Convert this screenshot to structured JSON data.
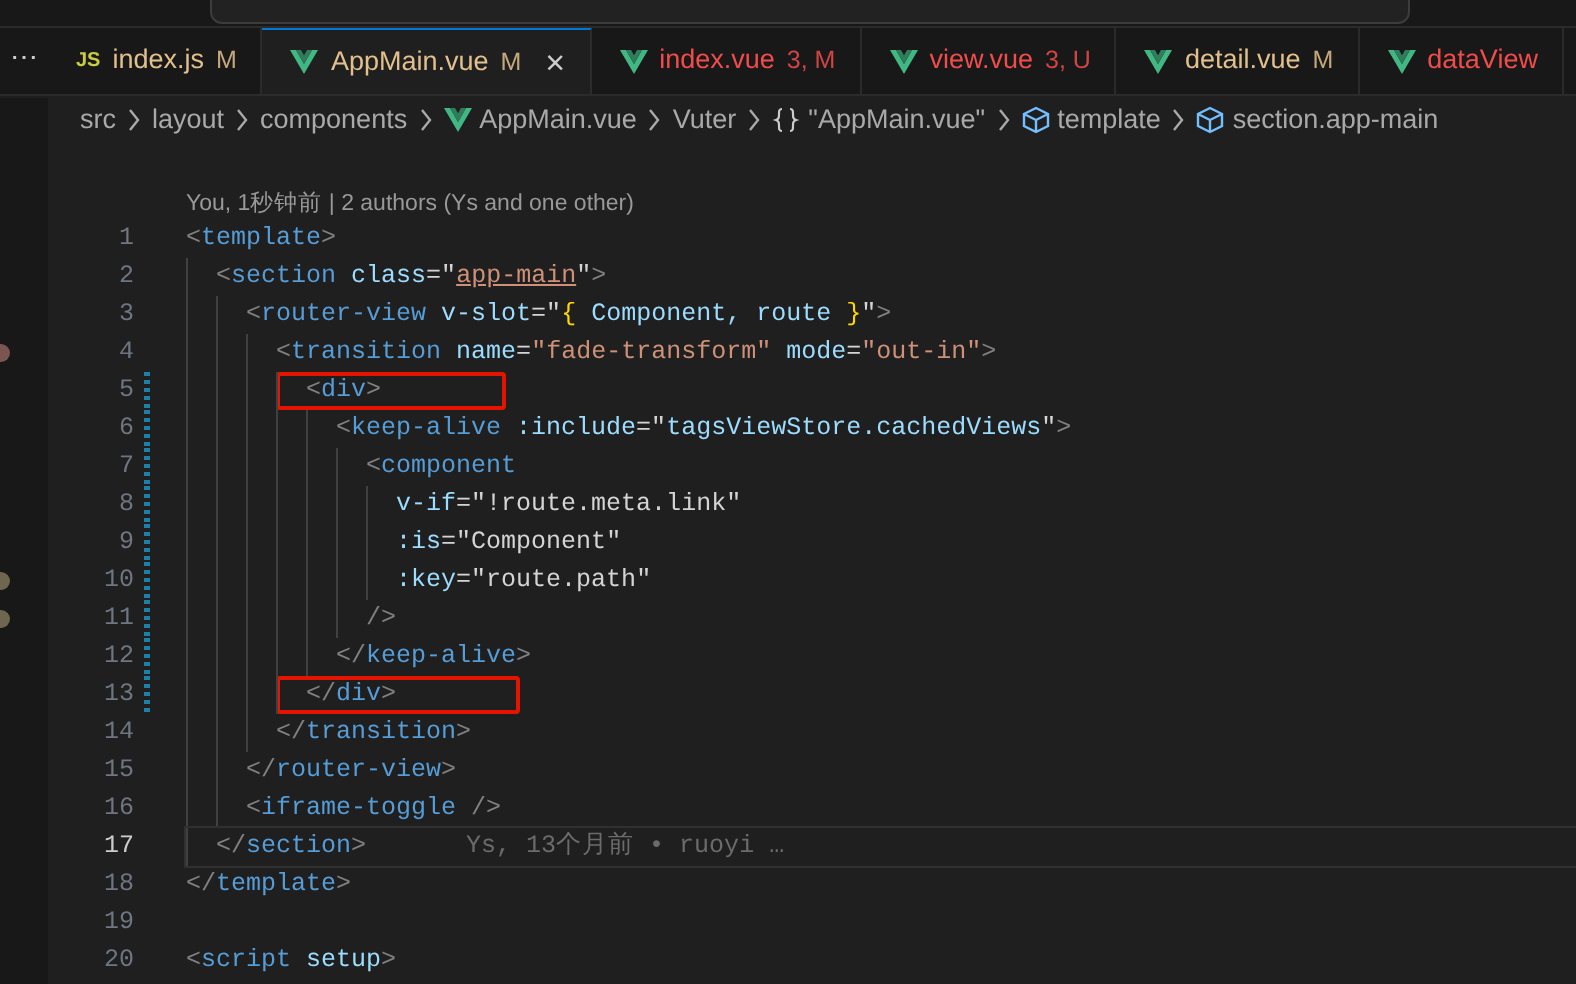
{
  "activity_more": "⋯",
  "tabs": [
    {
      "kind": "js",
      "icon_text": "JS",
      "label": "index.js",
      "status": "M",
      "color": "#e2c08d",
      "selected": false,
      "closable": false
    },
    {
      "kind": "vue",
      "label": "AppMain.vue",
      "status": "M",
      "color": "#e2c08d",
      "selected": true,
      "closable": true,
      "close": "×"
    },
    {
      "kind": "vue",
      "label": "index.vue",
      "status": "3, M",
      "color": "#f14c4c",
      "selected": false,
      "closable": false
    },
    {
      "kind": "vue",
      "label": "view.vue",
      "status": "3, U",
      "color": "#f14c4c",
      "selected": false,
      "closable": false
    },
    {
      "kind": "vue",
      "label": "detail.vue",
      "status": "M",
      "color": "#e2c08d",
      "selected": false,
      "closable": false
    },
    {
      "kind": "vue",
      "label": "dataView",
      "color": "#f14c4c",
      "selected": false,
      "closable": false
    }
  ],
  "breadcrumbs": [
    {
      "kind": "plain",
      "label": "src"
    },
    {
      "kind": "plain",
      "label": "layout"
    },
    {
      "kind": "plain",
      "label": "components"
    },
    {
      "kind": "vue",
      "label": "AppMain.vue"
    },
    {
      "kind": "plain",
      "label": "Vuter"
    },
    {
      "kind": "braces",
      "label": "\"AppMain.vue\""
    },
    {
      "kind": "cube",
      "label": "template"
    },
    {
      "kind": "cube",
      "label": "section.app-main"
    }
  ],
  "codelens": "You, 1秒钟前 | 2 authors (Ys and one other)",
  "lines": [
    {
      "number": "1",
      "tokens": [
        {
          "kind": "p",
          "t": "<"
        },
        {
          "kind": "tag",
          "t": "template"
        },
        {
          "kind": "p",
          "t": ">"
        }
      ]
    },
    {
      "number": "2",
      "tokens": [
        {
          "kind": "p",
          "t": "  <"
        },
        {
          "kind": "tag",
          "t": "section"
        },
        {
          "kind": "attr",
          "t": " class"
        },
        {
          "kind": "op",
          "t": "=\""
        },
        {
          "kind": "strlink",
          "t": "app-main"
        },
        {
          "kind": "op",
          "t": "\""
        },
        {
          "kind": "p",
          "t": ">"
        }
      ]
    },
    {
      "number": "3",
      "tokens": [
        {
          "kind": "p",
          "t": "    <"
        },
        {
          "kind": "tag",
          "t": "router-view"
        },
        {
          "kind": "attr",
          "t": " v-slot"
        },
        {
          "kind": "op",
          "t": "=\""
        },
        {
          "kind": "brace",
          "t": "{"
        },
        {
          "kind": "var",
          "t": " Component, route "
        },
        {
          "kind": "brace",
          "t": "}"
        },
        {
          "kind": "op",
          "t": "\""
        },
        {
          "kind": "p",
          "t": ">"
        }
      ]
    },
    {
      "number": "4",
      "color": "#7d5550",
      "tokens": [
        {
          "kind": "p",
          "t": "      <"
        },
        {
          "kind": "tag",
          "t": "transition"
        },
        {
          "kind": "attr",
          "t": " name"
        },
        {
          "kind": "op",
          "t": "="
        },
        {
          "kind": "str",
          "t": "\"fade-transform\""
        },
        {
          "kind": "attr",
          "t": " mode"
        },
        {
          "kind": "op",
          "t": "="
        },
        {
          "kind": "str",
          "t": "\"out-in\""
        },
        {
          "kind": "p",
          "t": ">"
        }
      ]
    },
    {
      "number": "5",
      "modified": true,
      "annotated": true,
      "tokens": [
        {
          "kind": "p",
          "t": "        <"
        },
        {
          "kind": "tag",
          "t": "div"
        },
        {
          "kind": "p",
          "t": ">"
        }
      ]
    },
    {
      "number": "6",
      "modified": true,
      "tokens": [
        {
          "kind": "p",
          "t": "          <"
        },
        {
          "kind": "tag",
          "t": "keep-alive"
        },
        {
          "kind": "attr",
          "t": " :include"
        },
        {
          "kind": "op",
          "t": "=\""
        },
        {
          "kind": "var",
          "t": "tagsViewStore.cachedViews"
        },
        {
          "kind": "op",
          "t": "\""
        },
        {
          "kind": "p",
          "t": ">"
        }
      ]
    },
    {
      "number": "7",
      "modified": true,
      "tokens": [
        {
          "kind": "p",
          "t": "            <"
        },
        {
          "kind": "tag",
          "t": "component"
        }
      ]
    },
    {
      "number": "8",
      "modified": true,
      "tokens": [
        {
          "kind": "attr",
          "t": "              v-if"
        },
        {
          "kind": "op",
          "t": "=\""
        },
        {
          "kind": "expr",
          "t": "!route.meta.link"
        },
        {
          "kind": "op",
          "t": "\""
        }
      ]
    },
    {
      "number": "9",
      "modified": true,
      "tokens": [
        {
          "kind": "attr",
          "t": "              :is"
        },
        {
          "kind": "op",
          "t": "=\""
        },
        {
          "kind": "expr",
          "t": "Component"
        },
        {
          "kind": "op",
          "t": "\""
        }
      ]
    },
    {
      "number": "10",
      "modified": true,
      "color": "#6f6650",
      "tokens": [
        {
          "kind": "attr",
          "t": "              :key"
        },
        {
          "kind": "op",
          "t": "=\""
        },
        {
          "kind": "expr",
          "t": "route.path"
        },
        {
          "kind": "op",
          "t": "\""
        }
      ]
    },
    {
      "number": "11",
      "modified": true,
      "color": "#6f6650",
      "tokens": [
        {
          "kind": "p",
          "t": "            />"
        }
      ]
    },
    {
      "number": "12",
      "modified": true,
      "tokens": [
        {
          "kind": "p",
          "t": "          </"
        },
        {
          "kind": "tag",
          "t": "keep-alive"
        },
        {
          "kind": "p",
          "t": ">"
        }
      ]
    },
    {
      "number": "13",
      "modified": true,
      "annotated": true,
      "tokens": [
        {
          "kind": "p",
          "t": "        </"
        },
        {
          "kind": "tag",
          "t": "div"
        },
        {
          "kind": "p",
          "t": ">"
        }
      ]
    },
    {
      "number": "14",
      "tokens": [
        {
          "kind": "p",
          "t": "      </"
        },
        {
          "kind": "tag",
          "t": "transition"
        },
        {
          "kind": "p",
          "t": ">"
        }
      ]
    },
    {
      "number": "15",
      "tokens": [
        {
          "kind": "p",
          "t": "    </"
        },
        {
          "kind": "tag",
          "t": "router-view"
        },
        {
          "kind": "p",
          "t": ">"
        }
      ]
    },
    {
      "number": "16",
      "tokens": [
        {
          "kind": "p",
          "t": "    <"
        },
        {
          "kind": "tag",
          "t": "iframe-toggle"
        },
        {
          "kind": "p",
          "t": " />"
        }
      ]
    },
    {
      "number": "17",
      "selected": true,
      "blame": "Ys, 13个月前 • ruoyi …",
      "tokens": [
        {
          "kind": "p",
          "t": "  </"
        },
        {
          "kind": "tag",
          "t": "section"
        },
        {
          "kind": "p",
          "t": ">"
        }
      ]
    },
    {
      "number": "18",
      "tokens": [
        {
          "kind": "p",
          "t": "</"
        },
        {
          "kind": "tag",
          "t": "template"
        },
        {
          "kind": "p",
          "t": ">"
        }
      ]
    },
    {
      "number": "19"
    },
    {
      "number": "20",
      "tokens": [
        {
          "kind": "p",
          "t": "<"
        },
        {
          "kind": "tag",
          "t": "script"
        },
        {
          "kind": "attr",
          "t": " setup"
        },
        {
          "kind": "p",
          "t": ">"
        }
      ]
    }
  ]
}
